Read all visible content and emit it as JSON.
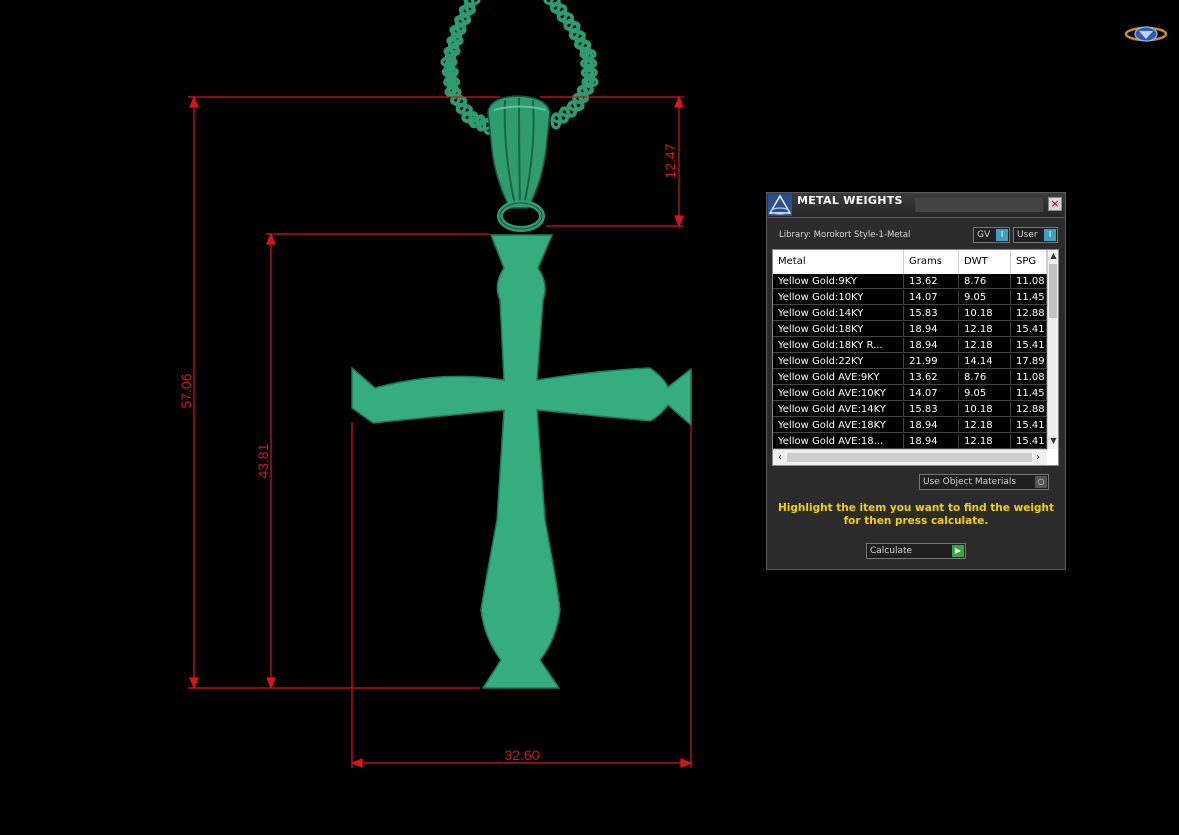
{
  "dimensions": {
    "overall_height": "57.06",
    "cross_height": "43.81",
    "bail_height": "12.47",
    "cross_width": "32.60"
  },
  "colors": {
    "model": "#36ad7e",
    "model_dark": "#1d7a55",
    "dimension_lines": "#d9141c",
    "instructions_text": "#f1d200",
    "background": "#000000"
  },
  "panel": {
    "title": "METAL WEIGHTS",
    "close_label": "×",
    "library_label": "Library: Morokort Style-1-Metal",
    "gv_label": "GV",
    "user_label": "User",
    "toggle_glyph": "I",
    "columns": [
      "Metal",
      "Grams",
      "DWT",
      "SPG"
    ],
    "rows": [
      [
        "Yellow Gold:9KY",
        "13.62",
        "8.76",
        "11.08"
      ],
      [
        "Yellow Gold:10KY",
        "14.07",
        "9.05",
        "11.45"
      ],
      [
        "Yellow Gold:14KY",
        "15.83",
        "10.18",
        "12.88"
      ],
      [
        "Yellow Gold:18KY",
        "18.94",
        "12.18",
        "15.41"
      ],
      [
        "Yellow Gold:18KY R...",
        "18.94",
        "12.18",
        "15.41"
      ],
      [
        "Yellow Gold:22KY",
        "21.99",
        "14.14",
        "17.89"
      ],
      [
        "Yellow Gold AVE:9KY",
        "13.62",
        "8.76",
        "11.08"
      ],
      [
        "Yellow Gold AVE:10KY",
        "14.07",
        "9.05",
        "11.45"
      ],
      [
        "Yellow Gold AVE:14KY",
        "15.83",
        "10.18",
        "12.88"
      ],
      [
        "Yellow Gold AVE:18KY",
        "18.94",
        "12.18",
        "15.41"
      ],
      [
        "Yellow Gold AVE:18...",
        "18.94",
        "12.18",
        "15.41"
      ]
    ],
    "use_object_label": "Use Object Materials",
    "instructions": "Highlight the item you want to find the weight for then press calculate.",
    "calculate_label": "Calculate"
  }
}
